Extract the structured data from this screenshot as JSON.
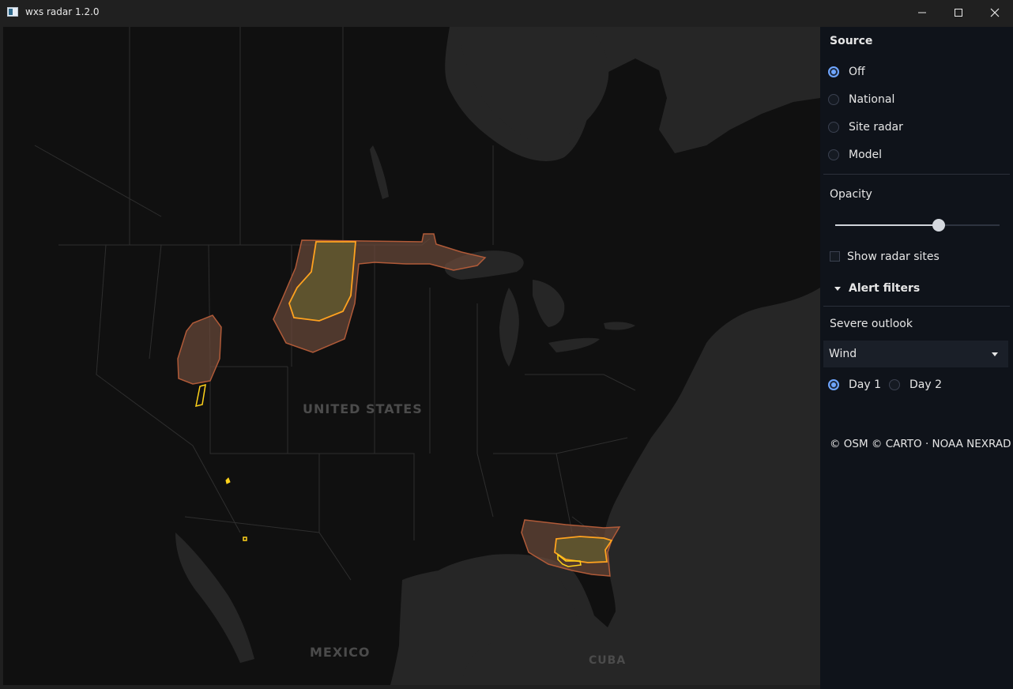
{
  "window": {
    "title": "wxs radar 1.2.0"
  },
  "map": {
    "labels": {
      "country_us": "UNITED STATES",
      "country_mx": "MEXICO",
      "country_cu": "CUBA"
    },
    "colors": {
      "water": "#262626",
      "land": "#101010",
      "border": "#3a3a3a",
      "outlook_fill": "#6b4a3a",
      "outlook_edge": "#b05a38",
      "enhanced_edge": "#ffa21f",
      "marginal_edge": "#ffd21a"
    }
  },
  "panel": {
    "source": {
      "title": "Source",
      "options": [
        {
          "label": "Off",
          "checked": true
        },
        {
          "label": "National",
          "checked": false
        },
        {
          "label": "Site radar",
          "checked": false
        },
        {
          "label": "Model",
          "checked": false
        }
      ]
    },
    "opacity": {
      "label": "Opacity",
      "value": 0.63
    },
    "show_radar_sites": {
      "label": "Show radar sites",
      "checked": false
    },
    "alert_filters": {
      "label": "Alert filters",
      "expanded": true
    },
    "severe_outlook": {
      "label": "Severe outlook",
      "selected": "Wind",
      "days": [
        {
          "label": "Day 1",
          "checked": true
        },
        {
          "label": "Day 2",
          "checked": false
        }
      ]
    },
    "attribution": "© OSM © CARTO · NOAA NEXRAD"
  }
}
